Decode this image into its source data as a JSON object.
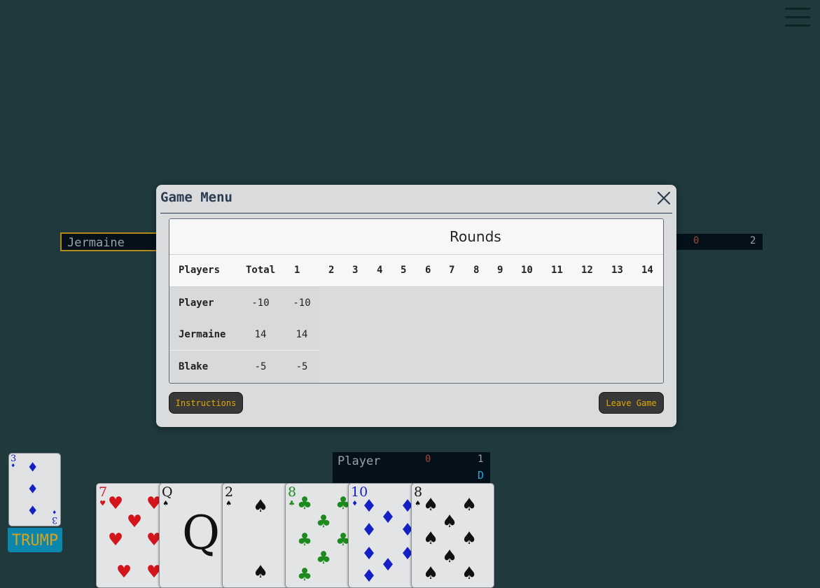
{
  "opponents": {
    "left": {
      "name": "Jermaine"
    },
    "right": {
      "score": "0",
      "tricks": "2"
    }
  },
  "player_box": {
    "name": "Player",
    "score": "0",
    "tricks": "1",
    "dealer": "D"
  },
  "trump": {
    "label": "TRUMP",
    "card": {
      "rank": "3",
      "suit": "diamonds",
      "suit_symbol": "♦"
    }
  },
  "hand": [
    {
      "rank": "7",
      "suit": "hearts",
      "suit_symbol": "♥",
      "color": "#d3141a"
    },
    {
      "rank": "Q",
      "suit": "spades",
      "suit_symbol": "♠",
      "color": "#111111"
    },
    {
      "rank": "2",
      "suit": "spades",
      "suit_symbol": "♠",
      "color": "#111111"
    },
    {
      "rank": "8",
      "suit": "clubs",
      "suit_symbol": "♣",
      "color": "#1c8a1c"
    },
    {
      "rank": "10",
      "suit": "diamonds",
      "suit_symbol": "♦",
      "color": "#1420c4"
    },
    {
      "rank": "8",
      "suit": "spades",
      "suit_symbol": "♠",
      "color": "#111111"
    }
  ],
  "modal": {
    "title": "Game Menu",
    "rounds_heading": "Rounds",
    "columns": [
      "Players",
      "Total",
      "1",
      "2",
      "3",
      "4",
      "5",
      "6",
      "7",
      "8",
      "9",
      "10",
      "11",
      "12",
      "13",
      "14"
    ],
    "rows": [
      {
        "name": "Player",
        "total": "-10",
        "r1": "-10"
      },
      {
        "name": "Jermaine",
        "total": "14",
        "r1": "14"
      },
      {
        "name": "Blake",
        "total": "-5",
        "r1": "-5"
      }
    ],
    "instructions_label": "Instructions",
    "leave_label": "Leave Game"
  },
  "colors": {
    "table_bg": "#1f393c",
    "button_text": "#e0a800",
    "trump_label_bg": "#0b86ad",
    "dealer_marker": "#2aa7d6"
  }
}
